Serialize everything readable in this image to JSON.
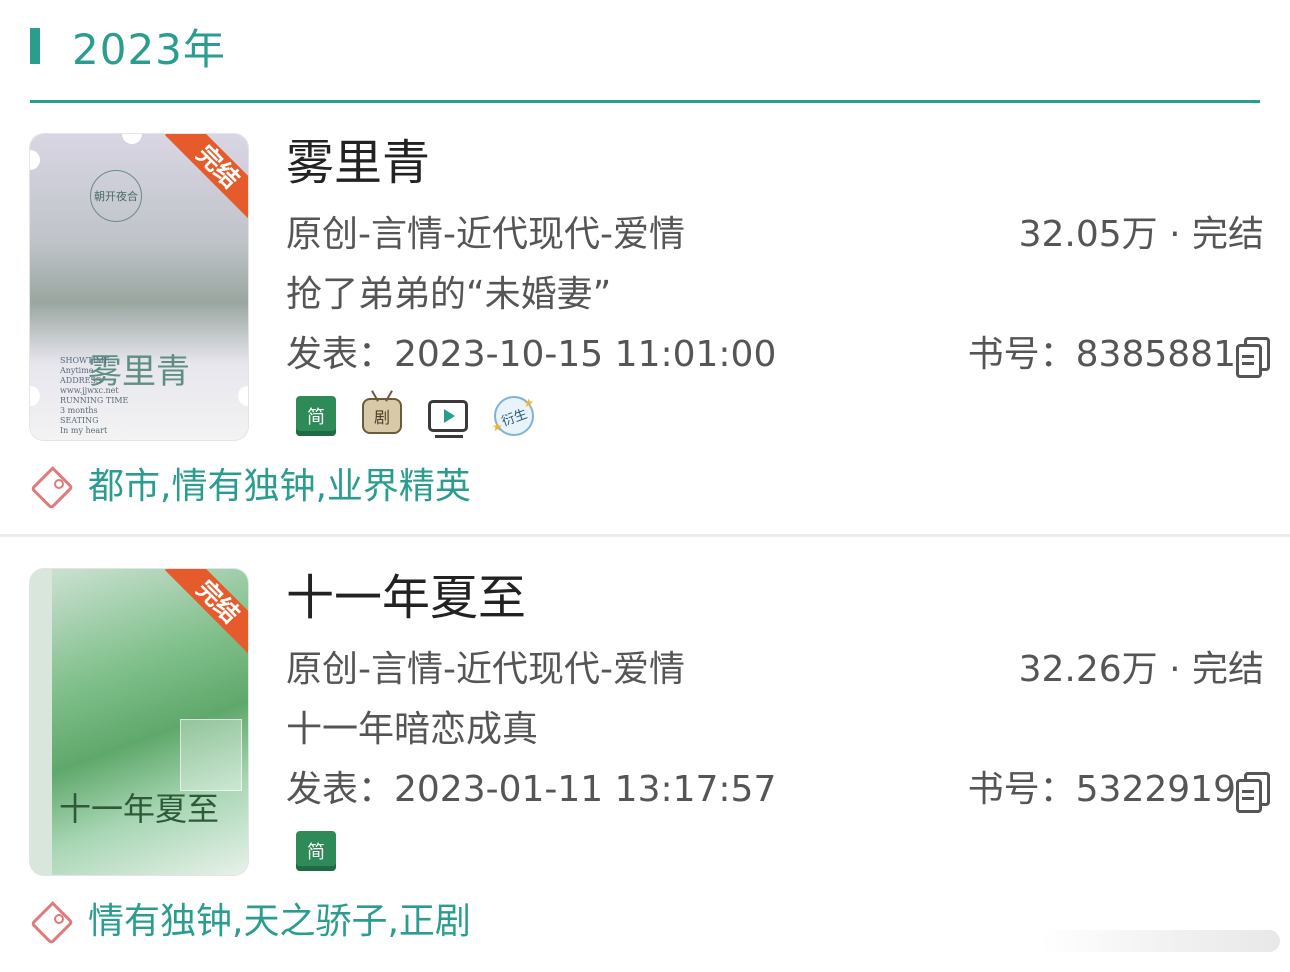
{
  "year_header": {
    "title": "2023年"
  },
  "books": [
    {
      "title": "雾里青",
      "category": "原创-言情-近代现代-爱情",
      "word_status": "32.05万 · 完结",
      "summary": "抢了弟弟的“未婚妻”",
      "published": "发表：2023-10-15 11:01:00",
      "book_id_label": "书号：",
      "book_id": "8385881",
      "badge": "完结",
      "cover": {
        "title": "雾里青",
        "seal": "朝开夜合",
        "meta": [
          "SHOWTIME",
          "Anytime",
          "ADDRESS",
          "www.jjwxc.net",
          "RUNNING TIME",
          "3 months",
          "SEATING",
          "In my heart"
        ]
      },
      "features": [
        {
          "icon": "simplified-book-icon",
          "label": "简"
        },
        {
          "icon": "tv-drama-icon",
          "label": "剧"
        },
        {
          "icon": "video-play-icon",
          "label": ""
        },
        {
          "icon": "derivative-icon",
          "label": "衍生"
        }
      ],
      "tags": "都市,情有独钟,业界精英"
    },
    {
      "title": "十一年夏至",
      "category": "原创-言情-近代现代-爱情",
      "word_status": "32.26万 · 完结",
      "summary": "十一年暗恋成真",
      "published": "发表：2023-01-11 13:17:57",
      "book_id_label": "书号：",
      "book_id": "5322919",
      "badge": "完结",
      "cover": {
        "title": "十一年夏至"
      },
      "features": [
        {
          "icon": "simplified-book-icon",
          "label": "简"
        }
      ],
      "tags": "情有独钟,天之骄子,正剧"
    }
  ],
  "colors": {
    "accent": "#2a9d8f",
    "badge": "#e55b2b",
    "tag_icon": "#e07b7b"
  }
}
